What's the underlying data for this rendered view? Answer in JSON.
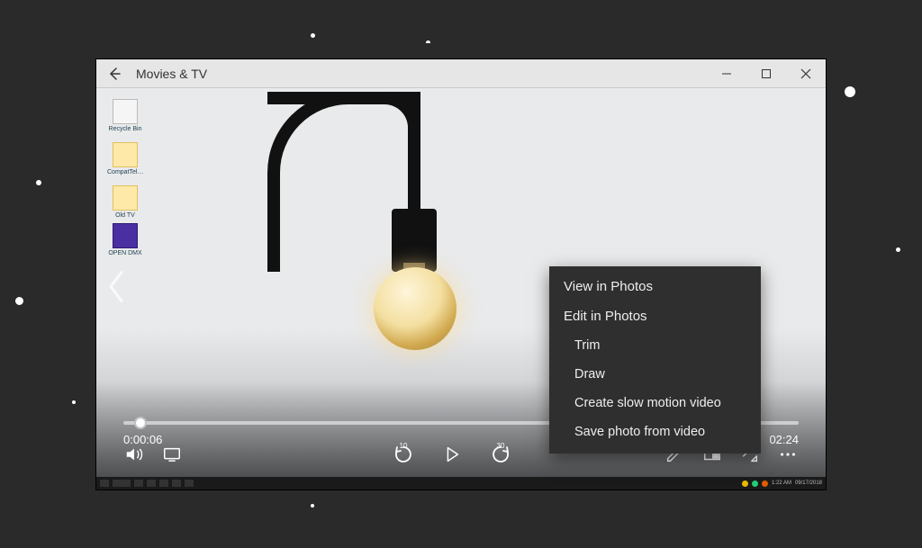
{
  "window": {
    "title": "Movies & TV",
    "back_label": "Back"
  },
  "desktop_icons": [
    {
      "label": "Recycle Bin"
    },
    {
      "label": "CompatTel…"
    },
    {
      "label": "Old TV"
    },
    {
      "label": "OPEN DMX"
    }
  ],
  "player": {
    "elapsed": "0:00:06",
    "remaining": "02:24",
    "skip_back": "10",
    "skip_fwd": "30"
  },
  "context_menu": {
    "view": "View in Photos",
    "edit": "Edit in Photos",
    "trim": "Trim",
    "draw": "Draw",
    "slowmo": "Create slow motion video",
    "savephoto": "Save photo from video"
  },
  "taskbar": {
    "time": "1:22 AM",
    "date": "09/17/2018"
  },
  "icon_names": {
    "back": "back-icon",
    "minimize": "minimize-icon",
    "maximize": "maximize-icon",
    "close": "close-icon",
    "volume": "volume-icon",
    "cast": "cast-icon",
    "skipback": "skip-back-icon",
    "play": "play-icon",
    "skipfwd": "skip-forward-icon",
    "edit": "pencil-icon",
    "mini": "miniplayer-icon",
    "fullscreen": "fullscreen-icon",
    "more": "more-icon",
    "prev": "previous-icon"
  }
}
